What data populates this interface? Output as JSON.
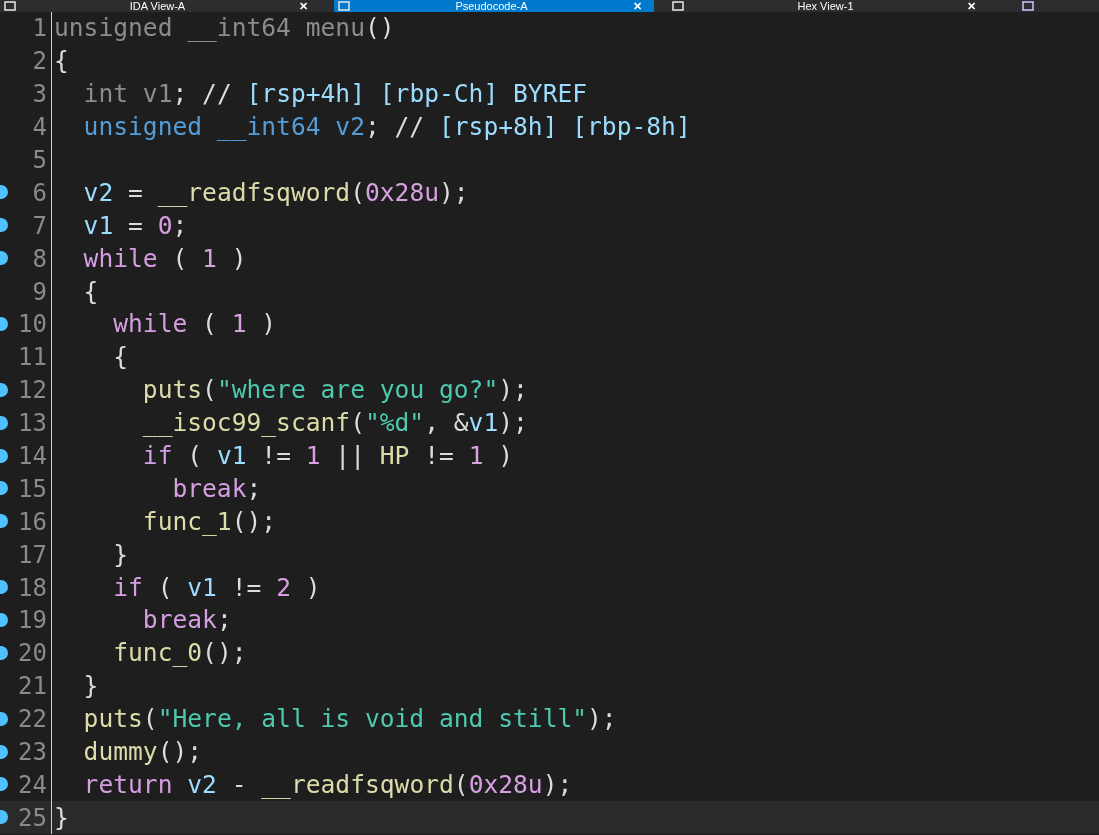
{
  "tabs": [
    {
      "label": "IDA View-A",
      "selected": false,
      "close": "✕"
    },
    {
      "label": "Pseudocode-A",
      "selected": true,
      "close": "✕"
    },
    {
      "label": "Hex View-1",
      "selected": false,
      "close": "✕"
    }
  ],
  "lines": [
    {
      "num": "1",
      "dot": false,
      "selected": false,
      "tokens": [
        {
          "t": "unsigned __int64 menu",
          "kind": "gray"
        },
        {
          "t": "()",
          "kind": "plain"
        }
      ]
    },
    {
      "num": "2",
      "dot": false,
      "selected": false,
      "tokens": [
        {
          "t": "{",
          "kind": "plain"
        }
      ]
    },
    {
      "num": "3",
      "dot": false,
      "selected": false,
      "tokens": [
        {
          "t": "  int v1",
          "kind": "gray"
        },
        {
          "t": "; // ",
          "kind": "plain"
        },
        {
          "t": "[rsp+4h] [rbp-Ch] BYREF",
          "kind": "var"
        }
      ]
    },
    {
      "num": "4",
      "dot": false,
      "selected": false,
      "tokens": [
        {
          "t": "  unsigned __int64 v2",
          "kind": "type"
        },
        {
          "t": "; // ",
          "kind": "plain"
        },
        {
          "t": "[rsp+8h] [rbp-8h]",
          "kind": "var"
        }
      ]
    },
    {
      "num": "5",
      "dot": false,
      "selected": false
    },
    {
      "num": "6",
      "dot": true,
      "selected": false,
      "tokens": [
        {
          "t": "  v2",
          "kind": "var"
        },
        {
          "t": " = ",
          "kind": "plain"
        },
        {
          "t": "__readfsqword",
          "kind": "func"
        },
        {
          "t": "(",
          "kind": "plain"
        },
        {
          "t": "0x28u",
          "kind": "num"
        },
        {
          "t": ");",
          "kind": "plain"
        }
      ]
    },
    {
      "num": "7",
      "dot": true,
      "selected": false,
      "tokens": [
        {
          "t": "  v1",
          "kind": "var"
        },
        {
          "t": " = ",
          "kind": "plain"
        },
        {
          "t": "0",
          "kind": "num"
        },
        {
          "t": ";",
          "kind": "plain"
        }
      ]
    },
    {
      "num": "8",
      "dot": true,
      "selected": false,
      "tokens": [
        {
          "t": "  while",
          "kind": "kw"
        },
        {
          "t": " ( ",
          "kind": "plain"
        },
        {
          "t": "1",
          "kind": "num"
        },
        {
          "t": " )",
          "kind": "plain"
        }
      ]
    },
    {
      "num": "9",
      "dot": false,
      "selected": false,
      "tokens": [
        {
          "t": "  {",
          "kind": "plain"
        }
      ]
    },
    {
      "num": "10",
      "dot": true,
      "selected": false,
      "tokens": [
        {
          "t": "    while",
          "kind": "kw"
        },
        {
          "t": " ( ",
          "kind": "plain"
        },
        {
          "t": "1",
          "kind": "num"
        },
        {
          "t": " )",
          "kind": "plain"
        }
      ]
    },
    {
      "num": "11",
      "dot": false,
      "selected": false,
      "tokens": [
        {
          "t": "    {",
          "kind": "plain"
        }
      ]
    },
    {
      "num": "12",
      "dot": true,
      "selected": false,
      "tokens": [
        {
          "t": "      puts",
          "kind": "func"
        },
        {
          "t": "(",
          "kind": "plain"
        },
        {
          "t": "\"where are you go?\"",
          "kind": "str"
        },
        {
          "t": ");",
          "kind": "plain"
        }
      ]
    },
    {
      "num": "13",
      "dot": true,
      "selected": false,
      "tokens": [
        {
          "t": "      __isoc99_scanf",
          "kind": "func"
        },
        {
          "t": "(",
          "kind": "plain"
        },
        {
          "t": "\"%d\"",
          "kind": "str"
        },
        {
          "t": ", &",
          "kind": "plain"
        },
        {
          "t": "v1",
          "kind": "var"
        },
        {
          "t": ");",
          "kind": "plain"
        }
      ]
    },
    {
      "num": "14",
      "dot": true,
      "selected": false,
      "tokens": [
        {
          "t": "      if",
          "kind": "kw"
        },
        {
          "t": " ( ",
          "kind": "plain"
        },
        {
          "t": "v1",
          "kind": "var"
        },
        {
          "t": " != ",
          "kind": "plain"
        },
        {
          "t": "1",
          "kind": "num"
        },
        {
          "t": " || ",
          "kind": "plain"
        },
        {
          "t": "HP",
          "kind": "func"
        },
        {
          "t": " != ",
          "kind": "plain"
        },
        {
          "t": "1",
          "kind": "num"
        },
        {
          "t": " )",
          "kind": "plain"
        }
      ]
    },
    {
      "num": "15",
      "dot": true,
      "selected": false,
      "tokens": [
        {
          "t": "        break",
          "kind": "kw"
        },
        {
          "t": ";",
          "kind": "plain"
        }
      ]
    },
    {
      "num": "16",
      "dot": true,
      "selected": false,
      "tokens": [
        {
          "t": "      func_1",
          "kind": "func"
        },
        {
          "t": "();",
          "kind": "plain"
        }
      ]
    },
    {
      "num": "17",
      "dot": false,
      "selected": false,
      "tokens": [
        {
          "t": "    }",
          "kind": "plain"
        }
      ]
    },
    {
      "num": "18",
      "dot": true,
      "selected": false,
      "tokens": [
        {
          "t": "    if",
          "kind": "kw"
        },
        {
          "t": " ( ",
          "kind": "plain"
        },
        {
          "t": "v1",
          "kind": "var"
        },
        {
          "t": " != ",
          "kind": "plain"
        },
        {
          "t": "2",
          "kind": "num"
        },
        {
          "t": " )",
          "kind": "plain"
        }
      ]
    },
    {
      "num": "19",
      "dot": true,
      "selected": false,
      "tokens": [
        {
          "t": "      break",
          "kind": "kw"
        },
        {
          "t": ";",
          "kind": "plain"
        }
      ]
    },
    {
      "num": "20",
      "dot": true,
      "selected": false,
      "tokens": [
        {
          "t": "    func_0",
          "kind": "func"
        },
        {
          "t": "();",
          "kind": "plain"
        }
      ]
    },
    {
      "num": "21",
      "dot": false,
      "selected": false,
      "tokens": [
        {
          "t": "  }",
          "kind": "plain"
        }
      ]
    },
    {
      "num": "22",
      "dot": true,
      "selected": false,
      "tokens": [
        {
          "t": "  puts",
          "kind": "func"
        },
        {
          "t": "(",
          "kind": "plain"
        },
        {
          "t": "\"Here, all is void and still\"",
          "kind": "str"
        },
        {
          "t": ");",
          "kind": "plain"
        }
      ]
    },
    {
      "num": "23",
      "dot": true,
      "selected": false,
      "tokens": [
        {
          "t": "  dummy",
          "kind": "func"
        },
        {
          "t": "();",
          "kind": "plain"
        }
      ]
    },
    {
      "num": "24",
      "dot": true,
      "selected": false,
      "tokens": [
        {
          "t": "  return",
          "kind": "kw"
        },
        {
          "t": " v2",
          "kind": "var"
        },
        {
          "t": " - ",
          "kind": "plain"
        },
        {
          "t": "__readfsqword",
          "kind": "func"
        },
        {
          "t": "(",
          "kind": "plain"
        },
        {
          "t": "0x28u",
          "kind": "num"
        },
        {
          "t": ");",
          "kind": "plain"
        }
      ]
    },
    {
      "num": "25",
      "dot": true,
      "selected": true,
      "tokens": [
        {
          "t": "}",
          "kind": "plain"
        }
      ]
    }
  ]
}
